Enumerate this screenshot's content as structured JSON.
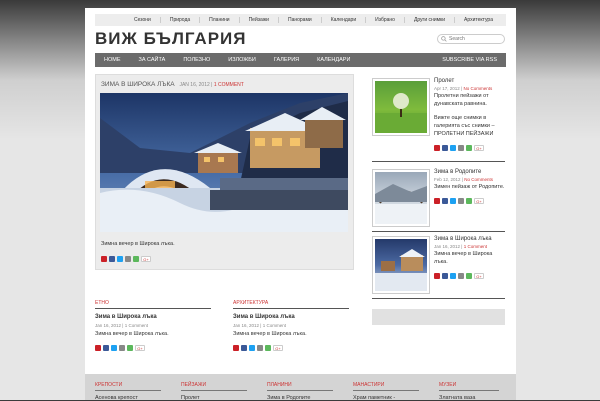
{
  "topnav": [
    "Сезони",
    "Природа",
    "Планини",
    "Пейзажи",
    "Панорами",
    "Календари",
    "Избрано",
    "Други снимки",
    "Архитектура"
  ],
  "site": {
    "title": "ВИЖ БЪЛГАРИЯ",
    "search_placeholder": "Search"
  },
  "mainnav": {
    "items": [
      "HOME",
      "ЗА САЙТА",
      "ПОЛЕЗНО",
      "ИЗЛОЖБИ",
      "ГАЛЕРИЯ",
      "КАЛЕНДАРИ"
    ],
    "rss": "SUBSCRIBE VIA RSS"
  },
  "featured": {
    "title": "ЗИМА В ШИРОКА ЛЪКА",
    "date": "JAN 16, 2012",
    "sep": " | ",
    "comments": "1 COMMENT",
    "excerpt": "Зимна вечер в Широка лъка."
  },
  "sidebar": [
    {
      "title": "Пролет",
      "date": "Apr 17, 2012",
      "comments": "No Comments",
      "excerpt": "Пролетни пейзажи от дунавската равнина.",
      "excerpt2": "Вижте още снимки в галерията със снимки – ПРОЛЕТНИ ПЕЙЗАЖИ"
    },
    {
      "title": "Зима в Родопите",
      "date": "Feb 12, 2012",
      "comments": "No Comments",
      "excerpt": "Зимен пейзаж от Родопите."
    },
    {
      "title": "Зима в Широка лъка",
      "date": "Jan 16, 2012",
      "comments": "1 Comment",
      "excerpt": "Зимна вечер в Широка лъка."
    }
  ],
  "lower": [
    {
      "category": "ЕТНО",
      "title": "Зима в Широка лъка",
      "meta": "Jan 16, 2012 | 1 Comment",
      "excerpt": "Зимна вечер в Широка лъка."
    },
    {
      "category": "АРХИТЕКТУРА",
      "title": "Зима в Широка лъка",
      "meta": "Jan 16, 2012 | 1 Comment",
      "excerpt": "Зимна вечер в Широка лъка."
    }
  ],
  "footer": [
    {
      "heading": "КРЕПОСТИ",
      "item": "Асенова крепост"
    },
    {
      "heading": "ПЕЙЗАЖИ",
      "item": "Пролет"
    },
    {
      "heading": "ПЛАНИНИ",
      "item": "Зима в Родопите"
    },
    {
      "heading": "МАНАСТИРИ",
      "item": "Храм паметник -"
    },
    {
      "heading": "МУЗЕИ",
      "item": "Златната ваза"
    }
  ],
  "share_plus": "G+",
  "colors": {
    "accent": "#cc3333",
    "nav": "#6b6b6b"
  }
}
